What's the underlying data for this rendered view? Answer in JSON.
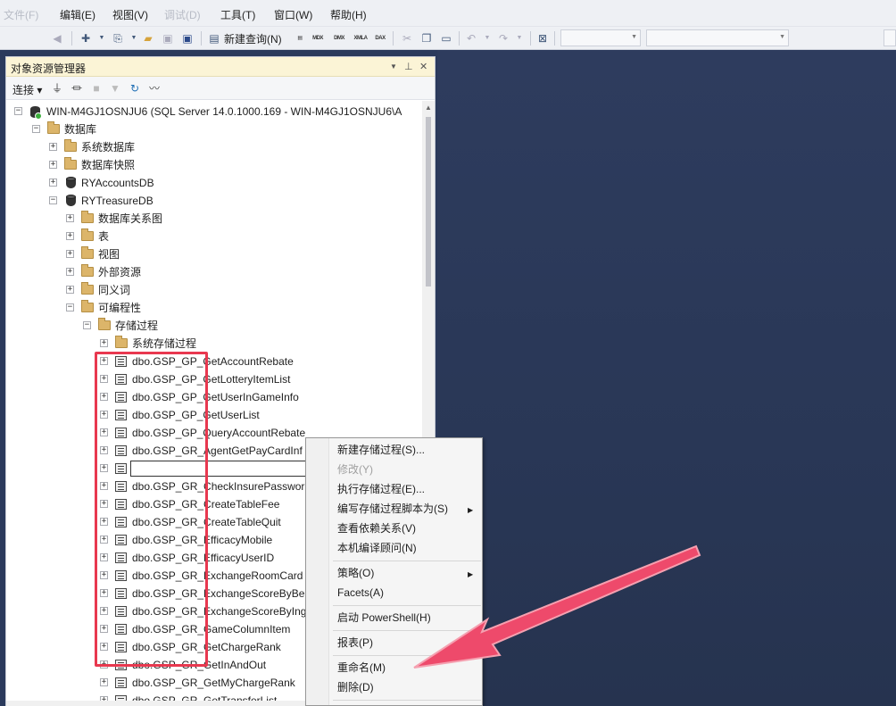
{
  "menubar": {
    "items": [
      {
        "label": "文件(F)",
        "faded": true
      },
      {
        "label": "编辑(E)"
      },
      {
        "label": "视图(V)"
      },
      {
        "label": "调试(D)",
        "faded": true
      },
      {
        "label": "工具(T)"
      },
      {
        "label": "窗口(W)"
      },
      {
        "label": "帮助(H)"
      }
    ]
  },
  "toolbar": {
    "new_query_label": "新建查询(N)",
    "mdx": "MDX",
    "dmx": "DMX",
    "xmla": "XMLA",
    "dax": "DAX"
  },
  "panel": {
    "title": "对象资源管理器",
    "connect_label": "连接",
    "pin_icon": "pin-icon",
    "close_icon": "close-icon"
  },
  "tree": {
    "server": "WIN-M4GJ1OSNJU6 (SQL Server 14.0.1000.169 - WIN-M4GJ1OSNJU6\\A",
    "databases": "数据库",
    "system_databases": "系统数据库",
    "database_snapshots": "数据库快照",
    "ry_accounts_db": "RYAccountsDB",
    "ry_treasure_db": "RYTreasureDB",
    "db_diagrams": "数据库关系图",
    "tables": "表",
    "views": "视图",
    "external_resources": "外部资源",
    "synonyms": "同义词",
    "programmability": "可编程性",
    "stored_procedures": "存储过程",
    "system_stored_procedures": "系统存储过程",
    "procs": [
      "dbo.GSP_GP_GetAccountRebate",
      "dbo.GSP_GP_GetLotteryItemList",
      "dbo.GSP_GP_GetUserInGameInfo",
      "dbo.GSP_GP_GetUserList",
      "dbo.GSP_GP_QueryAccountRebate",
      "dbo.GSP_GR_AgentGetPayCardInf",
      "",
      "dbo.GSP_GR_CheckInsurePasswor",
      "dbo.GSP_GR_CreateTableFee",
      "dbo.GSP_GR_CreateTableQuit",
      "dbo.GSP_GR_EfficacyMobile",
      "dbo.GSP_GR_EfficacyUserID",
      "dbo.GSP_GR_ExchangeRoomCard",
      "dbo.GSP_GR_ExchangeScoreByBe",
      "dbo.GSP_GR_ExchangeScoreByIng",
      "dbo.GSP_GR_GameColumnItem",
      "dbo.GSP_GR_GetChargeRank",
      "dbo.GSP_GR_GetInAndOut",
      "dbo.GSP_GR_GetMyChargeRank",
      "dbo.GSP_GR_GetTransferList"
    ]
  },
  "context_menu": {
    "new_proc": "新建存储过程(S)...",
    "modify": "修改(Y)",
    "execute": "执行存储过程(E)...",
    "script_as": "编写存储过程脚本为(S)",
    "view_deps": "查看依赖关系(V)",
    "tuning_advisor": "本机编译顾问(N)",
    "policies": "策略(O)",
    "facets": "Facets(A)",
    "powershell": "启动 PowerShell(H)",
    "reports": "报表(P)",
    "rename": "重命名(M)",
    "delete": "删除(D)"
  },
  "colors": {
    "highlight_red": "#e8384f",
    "arrow_pink": "#ee4a6b",
    "panel_title_bg": "#fbf4d6",
    "workspace": "#2b3a5c"
  }
}
